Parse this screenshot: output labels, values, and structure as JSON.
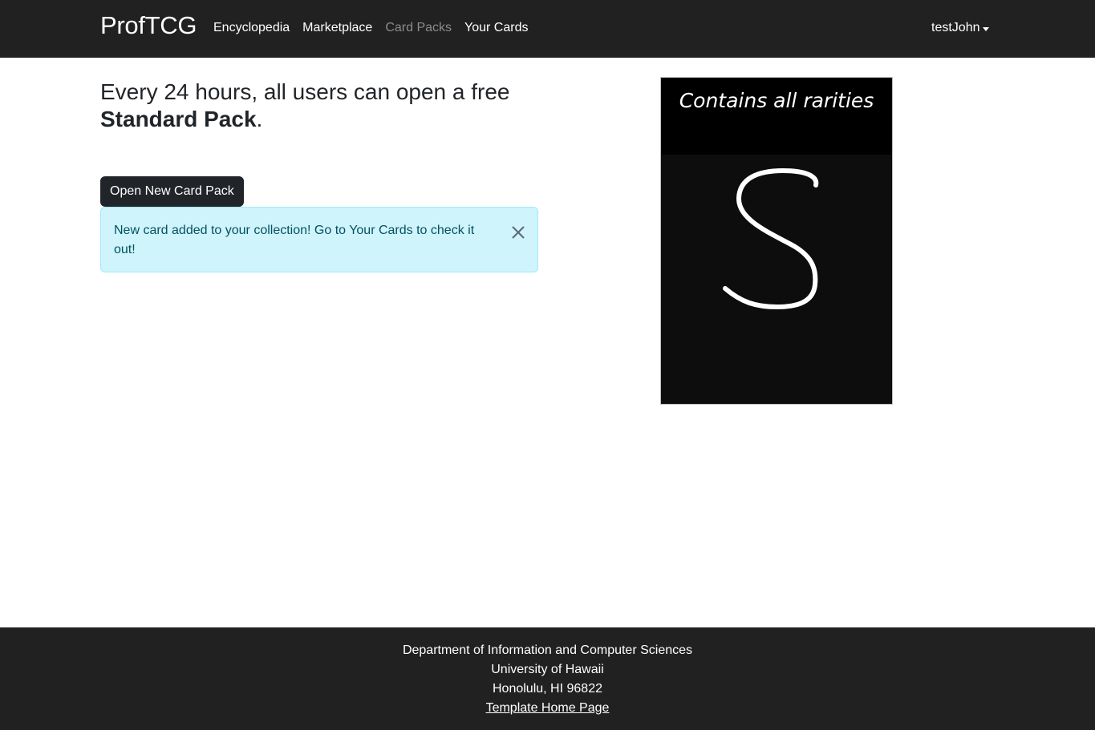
{
  "navbar": {
    "brand": "ProfTCG",
    "links": [
      {
        "label": "Encyclopedia",
        "active": true
      },
      {
        "label": "Marketplace",
        "active": true
      },
      {
        "label": "Card Packs",
        "active": false
      },
      {
        "label": "Your Cards",
        "active": true
      }
    ],
    "user": "testJohn"
  },
  "main": {
    "heading_text": "Every 24 hours, all users can open a free",
    "heading_bold": "Standard Pack",
    "heading_end": ".",
    "open_button": "Open New Card Pack",
    "alert": {
      "message": "New card added to your collection! Go to Your Cards to check it out!",
      "close_icon": "close-icon"
    }
  },
  "card_pack": {
    "caption": "Contains all rarities",
    "letter": "S"
  },
  "footer": {
    "department": "Department of Information and Computer Sciences",
    "university": "University of Hawaii",
    "address": "Honolulu, HI 96822",
    "link": "Template Home Page"
  },
  "colors": {
    "navbar_bg": "#212121",
    "alert_bg": "#cff4fc",
    "alert_text": "#055160",
    "button_bg": "#212529"
  }
}
